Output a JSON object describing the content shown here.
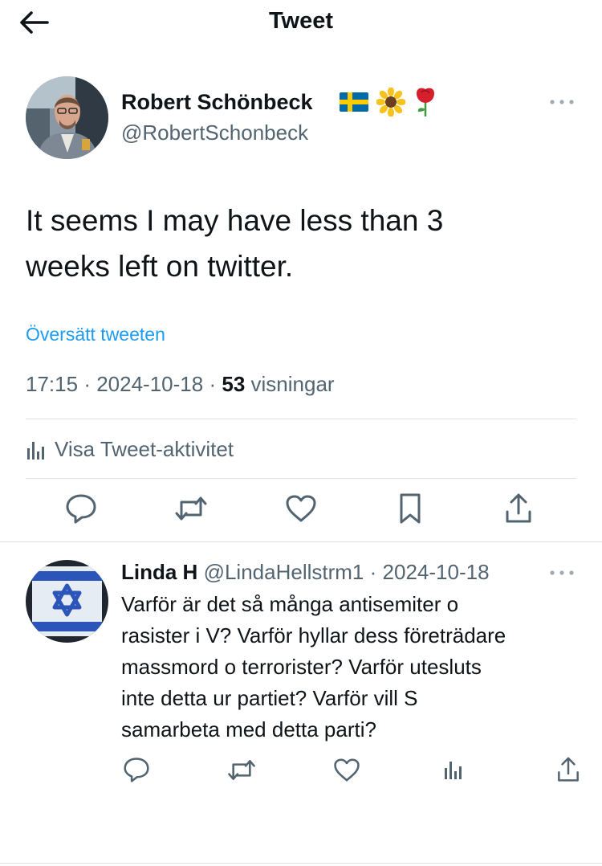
{
  "header": {
    "title": "Tweet",
    "back_icon": "arrow-left-icon"
  },
  "tweet": {
    "author_name": "Robert Schönbeck",
    "author_emoji": [
      "🇸🇪",
      "🌻",
      "🌹"
    ],
    "author_handle": "@RobertSchonbeck",
    "text_line1": "It seems I may have less than 3",
    "text_line2": "weeks left on twitter.",
    "translate_label": "Översätt tweeten",
    "time": "17:15",
    "sep1": "·",
    "date": "2024-10-18",
    "sep2": "·",
    "views_count": "53",
    "views_label": "visningar",
    "activity_label": "Visa Tweet-aktivitet",
    "actions": [
      "reply-icon",
      "retweet-icon",
      "like-icon",
      "bookmark-icon",
      "share-icon"
    ]
  },
  "reply": {
    "author_name": "Linda H",
    "author_handle": "@LindaHellstrm1",
    "sep": "·",
    "date": "2024-10-18",
    "text_lines": [
      "Varför är det så många antisemiter o",
      "rasister i V? Varför hyllar dess företrädare",
      "massmord o terrorister? Varför utesluts",
      "inte detta ur partiet? Varför vill S",
      "samarbeta med detta parti?"
    ],
    "actions": [
      "reply-icon",
      "retweet-icon",
      "like-icon",
      "analytics-icon",
      "share-icon"
    ]
  },
  "colors": {
    "text_primary": "#0f1419",
    "text_secondary": "#536471",
    "accent": "#1d9bf0",
    "icon": "#536471",
    "divider": "#dde2e6"
  }
}
